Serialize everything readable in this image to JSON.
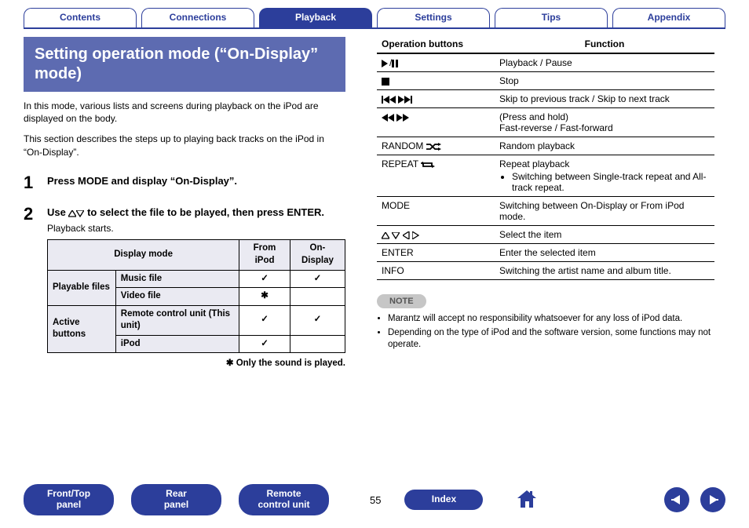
{
  "nav": {
    "tabs": [
      "Contents",
      "Connections",
      "Playback",
      "Settings",
      "Tips",
      "Appendix"
    ],
    "active_index": 2
  },
  "heading": "Setting operation mode (“On-Display” mode)",
  "intro": [
    "In this mode, various lists and screens during playback on the iPod are displayed on the body.",
    "This section describes the steps up to playing back tracks on the iPod in “On-Display”."
  ],
  "steps": [
    {
      "num": "1",
      "text": "Press MODE and display “On-Display”."
    },
    {
      "num": "2",
      "text_pre": "Use ",
      "text_post": " to select the file to be played, then press ENTER.",
      "sub": "Playback starts."
    }
  ],
  "dm_table": {
    "headers": [
      "Display mode",
      "From iPod",
      "On-Display"
    ],
    "rows": [
      {
        "cat": "Playable files",
        "sub": "Music file",
        "from": "✓",
        "on": "✓"
      },
      {
        "cat": "",
        "sub": "Video file",
        "from": "✱",
        "on": ""
      },
      {
        "cat": "Active buttons",
        "sub": "Remote control unit (This unit)",
        "from": "✓",
        "on": "✓"
      },
      {
        "cat": "",
        "sub": "iPod",
        "from": "✓",
        "on": ""
      }
    ],
    "footnote": "✱ Only the sound is played."
  },
  "op_table": {
    "headers": [
      "Operation buttons",
      "Function"
    ],
    "rows": [
      {
        "btn_icons": "play-pause",
        "func_html": "Playback / Pause"
      },
      {
        "btn_icons": "stop",
        "func_html": "Stop"
      },
      {
        "btn_icons": "skip",
        "func_html": "Skip to previous track / Skip to next track"
      },
      {
        "btn_icons": "rewff",
        "func_html": "(Press and hold)\nFast-reverse / Fast-forward"
      },
      {
        "btn_text": "RANDOM",
        "btn_icons": "shuffle",
        "func_html": "Random playback"
      },
      {
        "btn_text": "REPEAT",
        "btn_icons": "repeat",
        "func_html": "Repeat playback",
        "bullets": [
          "Switching between Single-track repeat and All-track repeat."
        ]
      },
      {
        "btn_text": "MODE",
        "func_html": "Switching between On-Display or From iPod mode."
      },
      {
        "btn_icons": "arrows4",
        "func_html": "Select the item"
      },
      {
        "btn_text": "ENTER",
        "func_html": "Enter the selected item"
      },
      {
        "btn_text": "INFO",
        "func_html": "Switching the artist name and album title."
      }
    ]
  },
  "note_label": "NOTE",
  "notes": [
    "Marantz will accept no responsibility whatsoever for any loss of iPod data.",
    "Depending on the type of iPod and the software version, some functions may not operate."
  ],
  "bottom": {
    "pills": [
      "Front/Top panel",
      "Rear panel",
      "Remote control unit"
    ],
    "page": "55",
    "index": "Index"
  }
}
